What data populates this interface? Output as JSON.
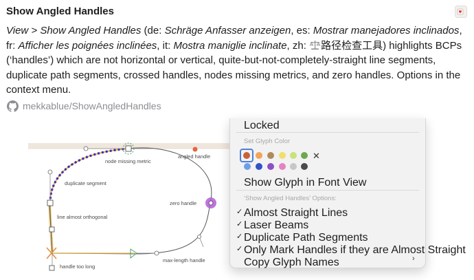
{
  "header": {
    "title": "Show Angled Handles",
    "badge_icon": "coffee-heart-icon"
  },
  "description": {
    "menu_path": "View > Show Angled Handles",
    "de_prefix": " (de: ",
    "de": "Schräge Anfasser anzeigen",
    "es_prefix": ", es: ",
    "es": "Mostrar manejadores inclinados",
    "fr_prefix": ", fr: ",
    "fr": "Afficher les poignées inclinées",
    "it_prefix": ", it: ",
    "it": "Mostra maniglie inclinate",
    "zh_prefix": ", zh: ",
    "zh_icon": "scales-icon",
    "zh": "路径检查工具",
    "body": ") highlights BCPs (‘handles’) which are not horizontal or vertical, quite-but-not-completely-straight line segments, duplicate path segments, crossed handles, nodes missing metrics, and zero handles. Options in the context menu."
  },
  "repo": {
    "icon": "github-icon",
    "text": "mekkablue/ShowAngledHandles"
  },
  "canvas": {
    "labels": {
      "node_missing_metric": "node missing metric",
      "angled_handle": "angled handle",
      "duplicate_segment": "duplicate segment",
      "zero_handle": "zero handle",
      "line_almost_orthogonal": "line almost orthogonal",
      "handle_too_long": "handle too long",
      "max_length_handle": "max-length handle"
    }
  },
  "context_menu": {
    "locked": "Locked",
    "set_glyph_color_header": "Set Glyph Color",
    "colors_row1": [
      "#c8623b",
      "#f2a45a",
      "#b08a5b",
      "#f2de6a",
      "#c9e27c",
      "#6ea84e"
    ],
    "colors_row2": [
      "#6f9ee6",
      "#3053c8",
      "#8e4fc4",
      "#e583c2",
      "#c7c7c7",
      "#4a4a4a"
    ],
    "clear_color_icon": "close-icon",
    "show_in_font_view": "Show Glyph in Font View",
    "options_header": "‘Show Angled Handles’ Options:",
    "options": [
      {
        "label": "Almost Straight Lines",
        "checked": true
      },
      {
        "label": "Laser Beams",
        "checked": true
      },
      {
        "label": "Duplicate Path Segments",
        "checked": true
      },
      {
        "label": "Only Mark Handles if they are Almost Straight",
        "checked": true
      }
    ],
    "checkmark": "✓",
    "copy_glyph_names": "Copy Glyph Names",
    "submenu_icon": "chevron-right-icon"
  }
}
